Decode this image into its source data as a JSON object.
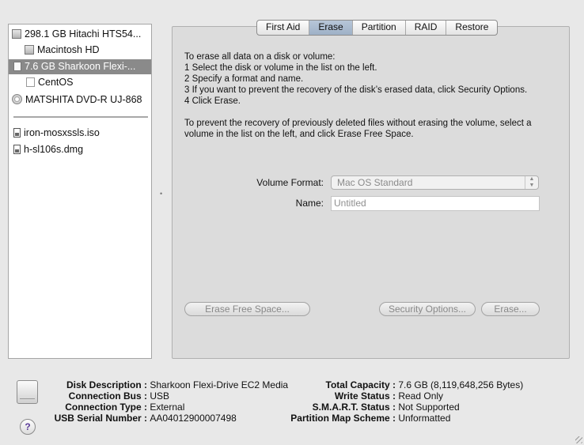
{
  "sidebar": {
    "items": [
      {
        "label": "298.1 GB Hitachi HTS54...",
        "icon": "hard-disk-icon"
      },
      {
        "label": "Macintosh HD",
        "icon": "hard-disk-volume-icon"
      },
      {
        "label": "7.6 GB Sharkoon Flexi-...",
        "icon": "external-disk-icon",
        "selected": true
      },
      {
        "label": "CentOS",
        "icon": "volume-icon"
      },
      {
        "label": "MATSHITA DVD-R UJ-868",
        "icon": "optical-disc-icon"
      },
      {
        "label": "iron-mosxssls.iso",
        "icon": "disk-image-icon"
      },
      {
        "label": "h-sl106s.dmg",
        "icon": "disk-image-icon"
      }
    ]
  },
  "tabs": [
    "First Aid",
    "Erase",
    "Partition",
    "RAID",
    "Restore"
  ],
  "active_tab": "Erase",
  "erase": {
    "instructions": [
      "To erase all data on a disk or volume:",
      "1 Select the disk or volume in the list on the left.",
      "2 Specify a format and name.",
      "3 If you want to prevent the recovery of the disk’s erased data, click Security Options.",
      "4 Click Erase."
    ],
    "free_space_note": [
      "To prevent the recovery of previously deleted files without erasing the volume, select a",
      "volume in the list on the left, and click Erase Free Space."
    ],
    "volume_format_label": "Volume Format:",
    "volume_format_value": "Mac OS Standard",
    "name_label": "Name:",
    "name_placeholder": "Untitled",
    "erase_free_space_button": "Erase Free Space...",
    "security_options_button": "Security Options...",
    "erase_button": "Erase..."
  },
  "info": {
    "left": [
      {
        "key": "Disk Description :",
        "value": "Sharkoon Flexi-Drive EC2 Media"
      },
      {
        "key": "Connection Bus :",
        "value": "USB"
      },
      {
        "key": "Connection Type :",
        "value": "External"
      },
      {
        "key": "USB Serial Number :",
        "value": "AA04012900007498"
      }
    ],
    "right": [
      {
        "key": "Total Capacity :",
        "value": "7.6 GB (8,119,648,256 Bytes)"
      },
      {
        "key": "Write Status :",
        "value": "Read Only"
      },
      {
        "key": "S.M.A.R.T. Status :",
        "value": "Not Supported"
      },
      {
        "key": "Partition Map Scheme :",
        "value": "Unformatted"
      }
    ]
  },
  "help_label": "?"
}
